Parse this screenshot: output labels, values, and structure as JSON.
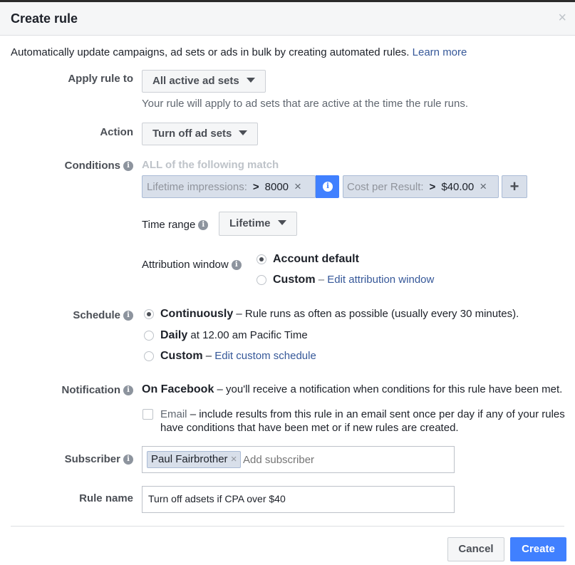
{
  "dialog": {
    "title": "Create rule",
    "close_glyph": "×",
    "intro_text": "Automatically update campaigns, ad sets or ads in bulk by creating automated rules.",
    "learn_more": "Learn more"
  },
  "apply_rule": {
    "label": "Apply rule to",
    "value": "All active ad sets",
    "helper": "Your rule will apply to ad sets that are active at the time the rule runs."
  },
  "action": {
    "label": "Action",
    "value": "Turn off ad sets"
  },
  "conditions": {
    "label": "Conditions",
    "match_text": "ALL of the following match",
    "items": [
      {
        "metric": "Lifetime impressions:",
        "operator": ">",
        "value": "8000"
      },
      {
        "metric": "Cost per Result:",
        "operator": ">",
        "value": "$40.00"
      }
    ],
    "add_glyph": "+",
    "remove_glyph": "×",
    "info_glyph": "i"
  },
  "time_range": {
    "label": "Time range",
    "value": "Lifetime"
  },
  "attribution": {
    "label": "Attribution window",
    "options": [
      {
        "label": "Account default",
        "selected": true
      },
      {
        "label": "Custom",
        "dash": "–",
        "link": "Edit attribution window",
        "selected": false
      }
    ]
  },
  "schedule": {
    "label": "Schedule",
    "options": [
      {
        "label": "Continuously",
        "dash": "–",
        "desc": "Rule runs as often as possible (usually every 30 minutes).",
        "selected": true
      },
      {
        "label": "Daily",
        "desc": "at 12.00 am Pacific Time",
        "selected": false
      },
      {
        "label": "Custom",
        "dash": "–",
        "link": "Edit custom schedule",
        "selected": false
      }
    ]
  },
  "notification": {
    "label": "Notification",
    "facebook_bold": "On Facebook",
    "facebook_desc": "– you'll receive a notification when conditions for this rule have been met.",
    "email_label": "Email",
    "email_desc_line1": "– include results from this rule in an email sent once per day if any of your rules",
    "email_desc_line2": "have conditions that have been met or if new rules are created.",
    "email_checked": false
  },
  "subscriber": {
    "label": "Subscriber",
    "token": "Paul Fairbrother",
    "placeholder": "Add subscriber"
  },
  "rule_name": {
    "label": "Rule name",
    "value": "Turn off adsets if CPA over $40"
  },
  "footer": {
    "cancel": "Cancel",
    "create": "Create"
  },
  "colors": {
    "primary": "#4080ff",
    "link": "#365899",
    "chip_bg": "#d8dfea"
  }
}
